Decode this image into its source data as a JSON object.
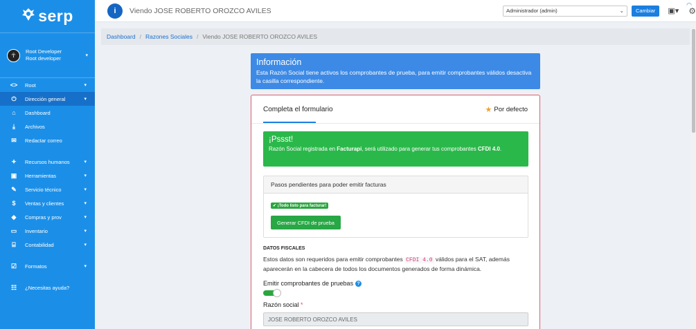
{
  "brand": {
    "name": "serp",
    "logo_icon": "seal-icon"
  },
  "user": {
    "line1": "Root Developer",
    "line2": "Root developer"
  },
  "sidebar": {
    "items": [
      {
        "icon": "<>",
        "label": "Root",
        "chevron": true,
        "active": false
      },
      {
        "icon": "⏻",
        "label": "Dirección general",
        "chevron": true,
        "active": true
      },
      {
        "icon": "⌂",
        "label": "Dashboard",
        "chevron": false,
        "active": false
      },
      {
        "icon": "⤓",
        "label": "Archivos",
        "chevron": false,
        "active": false
      },
      {
        "icon": "✉",
        "label": "Redactar correo",
        "chevron": false,
        "active": false
      }
    ],
    "items2": [
      {
        "icon": "✦",
        "label": "Recursos humanos",
        "chevron": true
      },
      {
        "icon": "▣",
        "label": "Herramientas",
        "chevron": true
      },
      {
        "icon": "✎",
        "label": "Servicio técnico",
        "chevron": true
      },
      {
        "icon": "$",
        "label": "Ventas y clientes",
        "chevron": true
      },
      {
        "icon": "◆",
        "label": "Compras y prov",
        "chevron": true
      },
      {
        "icon": "▭",
        "label": "Inventario",
        "chevron": true
      },
      {
        "icon": "⌸",
        "label": "Contabilidad",
        "chevron": true
      }
    ],
    "items3": [
      {
        "icon": "☑",
        "label": "Formatos",
        "chevron": true
      }
    ],
    "items4": [
      {
        "icon": "☷",
        "label": "¿Necesitas ayuda?",
        "chevron": false
      }
    ]
  },
  "topbar": {
    "title": "Viendo JOSE ROBERTO OROZCO AVILES",
    "role_selected": "Administrador (admin)",
    "cambiar_label": "Cambiar"
  },
  "breadcrumb": {
    "items": [
      "Dashboard",
      "Razones Sociales"
    ],
    "current": "Viendo JOSE ROBERTO OROZCO AVILES"
  },
  "info_alert": {
    "title": "Información",
    "text": "Esta Razón Social tiene activos los comprobantes de prueba, para emitir comprobantes válidos desactiva la casilla correspondiente."
  },
  "form": {
    "tab_label": "Completa el formulario",
    "default_label": "Por defecto",
    "success_title": "¡Pssst!",
    "success_pre": "Razón Social registrada en ",
    "success_bold1": "Facturapi",
    "success_mid": ", será utilizado para generar tus comprobantes ",
    "success_bold2": "CFDI 4.0",
    "success_end": ".",
    "steps_title": "Pasos pendientes para poder emitir facturas",
    "ready_badge": "✔ ¡Todo listo para facturar!",
    "generate_button": "Generar CFDI de prueba",
    "fiscal_heading": "DATOS FISCALES",
    "fiscal_pre": "Estos datos son requeridos para emitir comprobantes ",
    "fiscal_code": "CFDI 4.0",
    "fiscal_post": " válidos para el SAT, además aparecerán en la cabecera de todos los documentos generados de forma dinámica.",
    "emit_label": "Emitir comprobantes de pruebas",
    "emit_enabled": true,
    "razon_label": "Razón social",
    "razon_value": "JOSE ROBERTO OROZCO AVILES"
  },
  "colors": {
    "sidebar_bg": "#1b8fe8",
    "info_bg": "#3c8ae6",
    "success_bg": "#2bb84a",
    "card_border": "#e05c6c"
  }
}
